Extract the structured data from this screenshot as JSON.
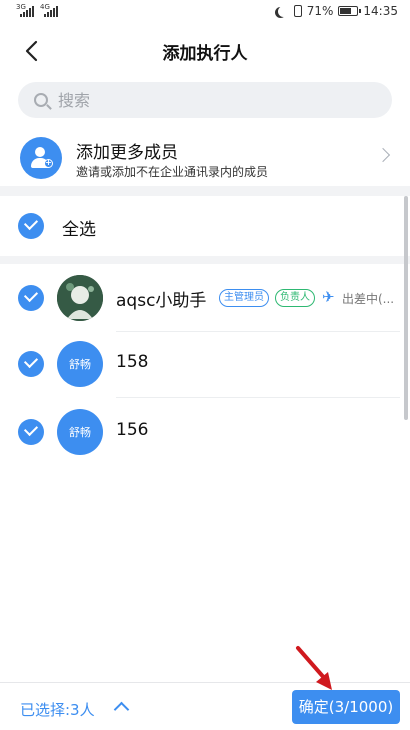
{
  "status_bar": {
    "sim1_network": "3G",
    "sim2_network": "4G",
    "battery_text": "71%",
    "battery_level": 0.71,
    "time": "14:35"
  },
  "header": {
    "title": "添加执行人",
    "back_icon": "chevron-left-icon"
  },
  "search": {
    "placeholder": "搜索",
    "value": ""
  },
  "add_more": {
    "title": "添加更多成员",
    "subtitle": "邀请或添加不在企业通讯录内的成员"
  },
  "select_all": {
    "label": "全选",
    "checked": true
  },
  "members": [
    {
      "name": "aqsc小助手",
      "avatar": "photo",
      "checked": true,
      "tags": [
        "主管理员",
        "负责人"
      ],
      "status_icon": "airplane-icon",
      "status_text": "出差中(..."
    },
    {
      "name": "158",
      "avatar_text": "舒畅",
      "checked": true
    },
    {
      "name": "156",
      "avatar_text": "舒畅",
      "checked": true
    }
  ],
  "bottom_bar": {
    "selected_label": "已选择:3人",
    "confirm_label": "确定(3/1000)"
  },
  "colors": {
    "accent": "#3d8ef0",
    "owner_tag": "#2eb872",
    "annotation_arrow": "#d0191e"
  }
}
